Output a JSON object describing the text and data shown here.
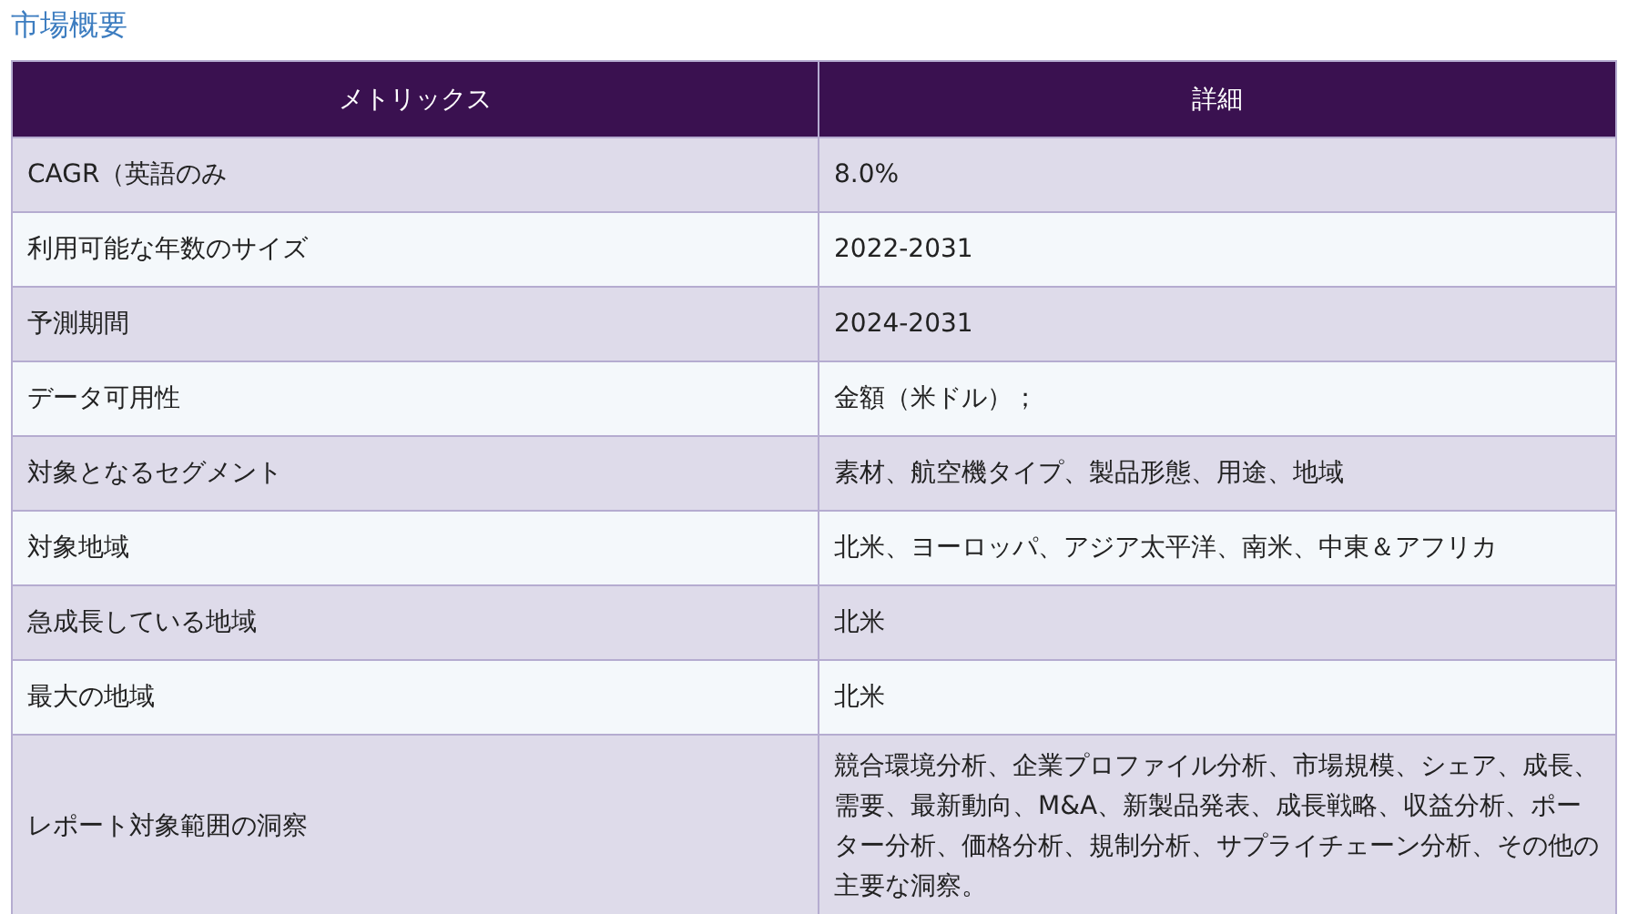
{
  "title": "市場概要",
  "table": {
    "columns": [
      "メトリックス",
      "詳細"
    ],
    "rows": [
      {
        "metric": "CAGR（英語のみ",
        "detail": "8.0%"
      },
      {
        "metric": "利用可能な年数のサイズ",
        "detail": "2022-2031"
      },
      {
        "metric": "予測期間",
        "detail": "2024-2031"
      },
      {
        "metric": "データ可用性",
        "detail": "金額（米ドル）；"
      },
      {
        "metric": "対象となるセグメント",
        "detail": "素材、航空機タイプ、製品形態、用途、地域"
      },
      {
        "metric": "対象地域",
        "detail": "北米、ヨーロッパ、アジア太平洋、南米、中東＆アフリカ"
      },
      {
        "metric": "急成長している地域",
        "detail": "北米"
      },
      {
        "metric": "最大の地域",
        "detail": "北米"
      },
      {
        "metric": "レポート対象範囲の洞察",
        "detail": "競合環境分析、企業プロファイル分析、市場規模、シェア、成長、需要、最新動向、M&A、新製品発表、成長戦略、収益分析、ポーター分析、価格分析、規制分析、サプライチェーン分析、その他の主要な洞察。"
      }
    ]
  }
}
